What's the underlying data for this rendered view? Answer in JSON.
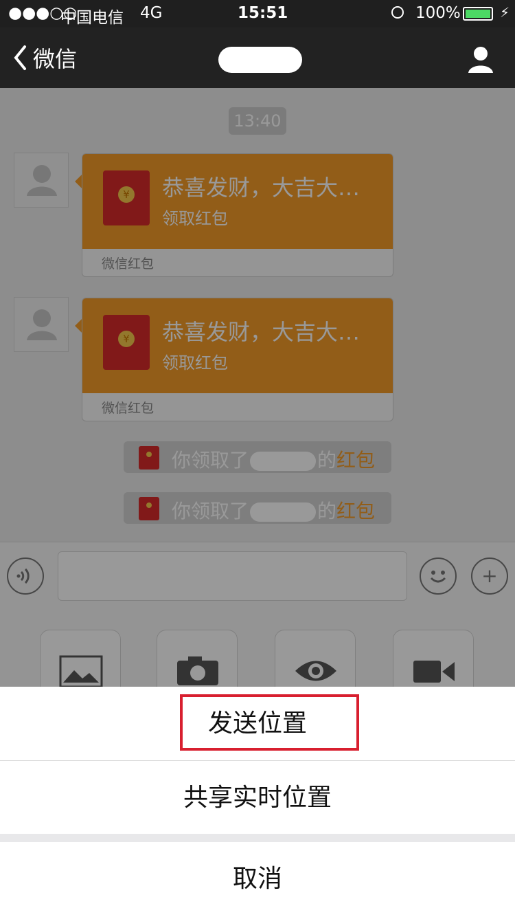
{
  "status_bar": {
    "signal": "●●●○○",
    "carrier": "中国电信",
    "network": "4G",
    "time": "15:51",
    "battery": "100%"
  },
  "nav": {
    "back_label": "微信"
  },
  "chat": {
    "timestamp": "13:40",
    "red_packets": [
      {
        "title": "恭喜发财，大吉大…",
        "subtitle": "领取红包",
        "footer": "微信红包"
      },
      {
        "title": "恭喜发财，大吉大…",
        "subtitle": "领取红包",
        "footer": "微信红包"
      }
    ],
    "system_messages": [
      {
        "prefix": "你领取了",
        "middle": "的",
        "suffix": "红包"
      },
      {
        "prefix": "你领取了",
        "middle": "的",
        "suffix": "红包"
      }
    ]
  },
  "action_sheet": {
    "send_location": "发送位置",
    "share_live_location": "共享实时位置",
    "cancel": "取消"
  },
  "colors": {
    "accent_red": "#d81f2f",
    "red_packet_orange": "#f39b28",
    "dark_bar": "#1f1f1f"
  }
}
